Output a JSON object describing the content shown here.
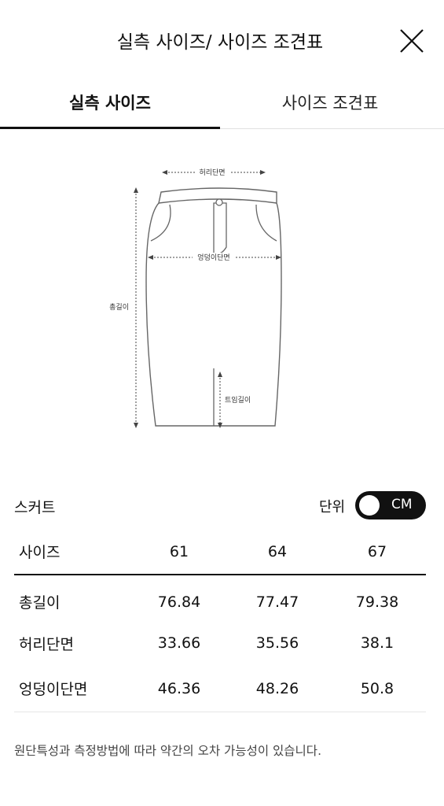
{
  "header": {
    "title": "실측 사이즈/ 사이즈 조견표",
    "close_icon": "close-icon"
  },
  "tabs": [
    {
      "label": "실측 사이즈",
      "active": true
    },
    {
      "label": "사이즈 조견표",
      "active": false
    }
  ],
  "diagram": {
    "waist_label": "허리단면",
    "hip_label": "엉덩이단면",
    "length_label": "총길이",
    "slit_label": "트임길이"
  },
  "product": {
    "name": "스커트",
    "unit_label": "단위",
    "unit_value": "CM"
  },
  "table": {
    "header": [
      "사이즈",
      "61",
      "64",
      "67"
    ],
    "rows": [
      [
        "총길이",
        "76.84",
        "77.47",
        "79.38"
      ],
      [
        "허리단면",
        "33.66",
        "35.56",
        "38.1"
      ],
      [
        "엉덩이단면",
        "46.36",
        "48.26",
        "50.8"
      ]
    ]
  },
  "notice": "원단특성과 측정방법에 따라 약간의 오차 가능성이 있습니다.",
  "colors": {
    "toggle_bg": "#111111",
    "divider": "#e0e0e0"
  }
}
